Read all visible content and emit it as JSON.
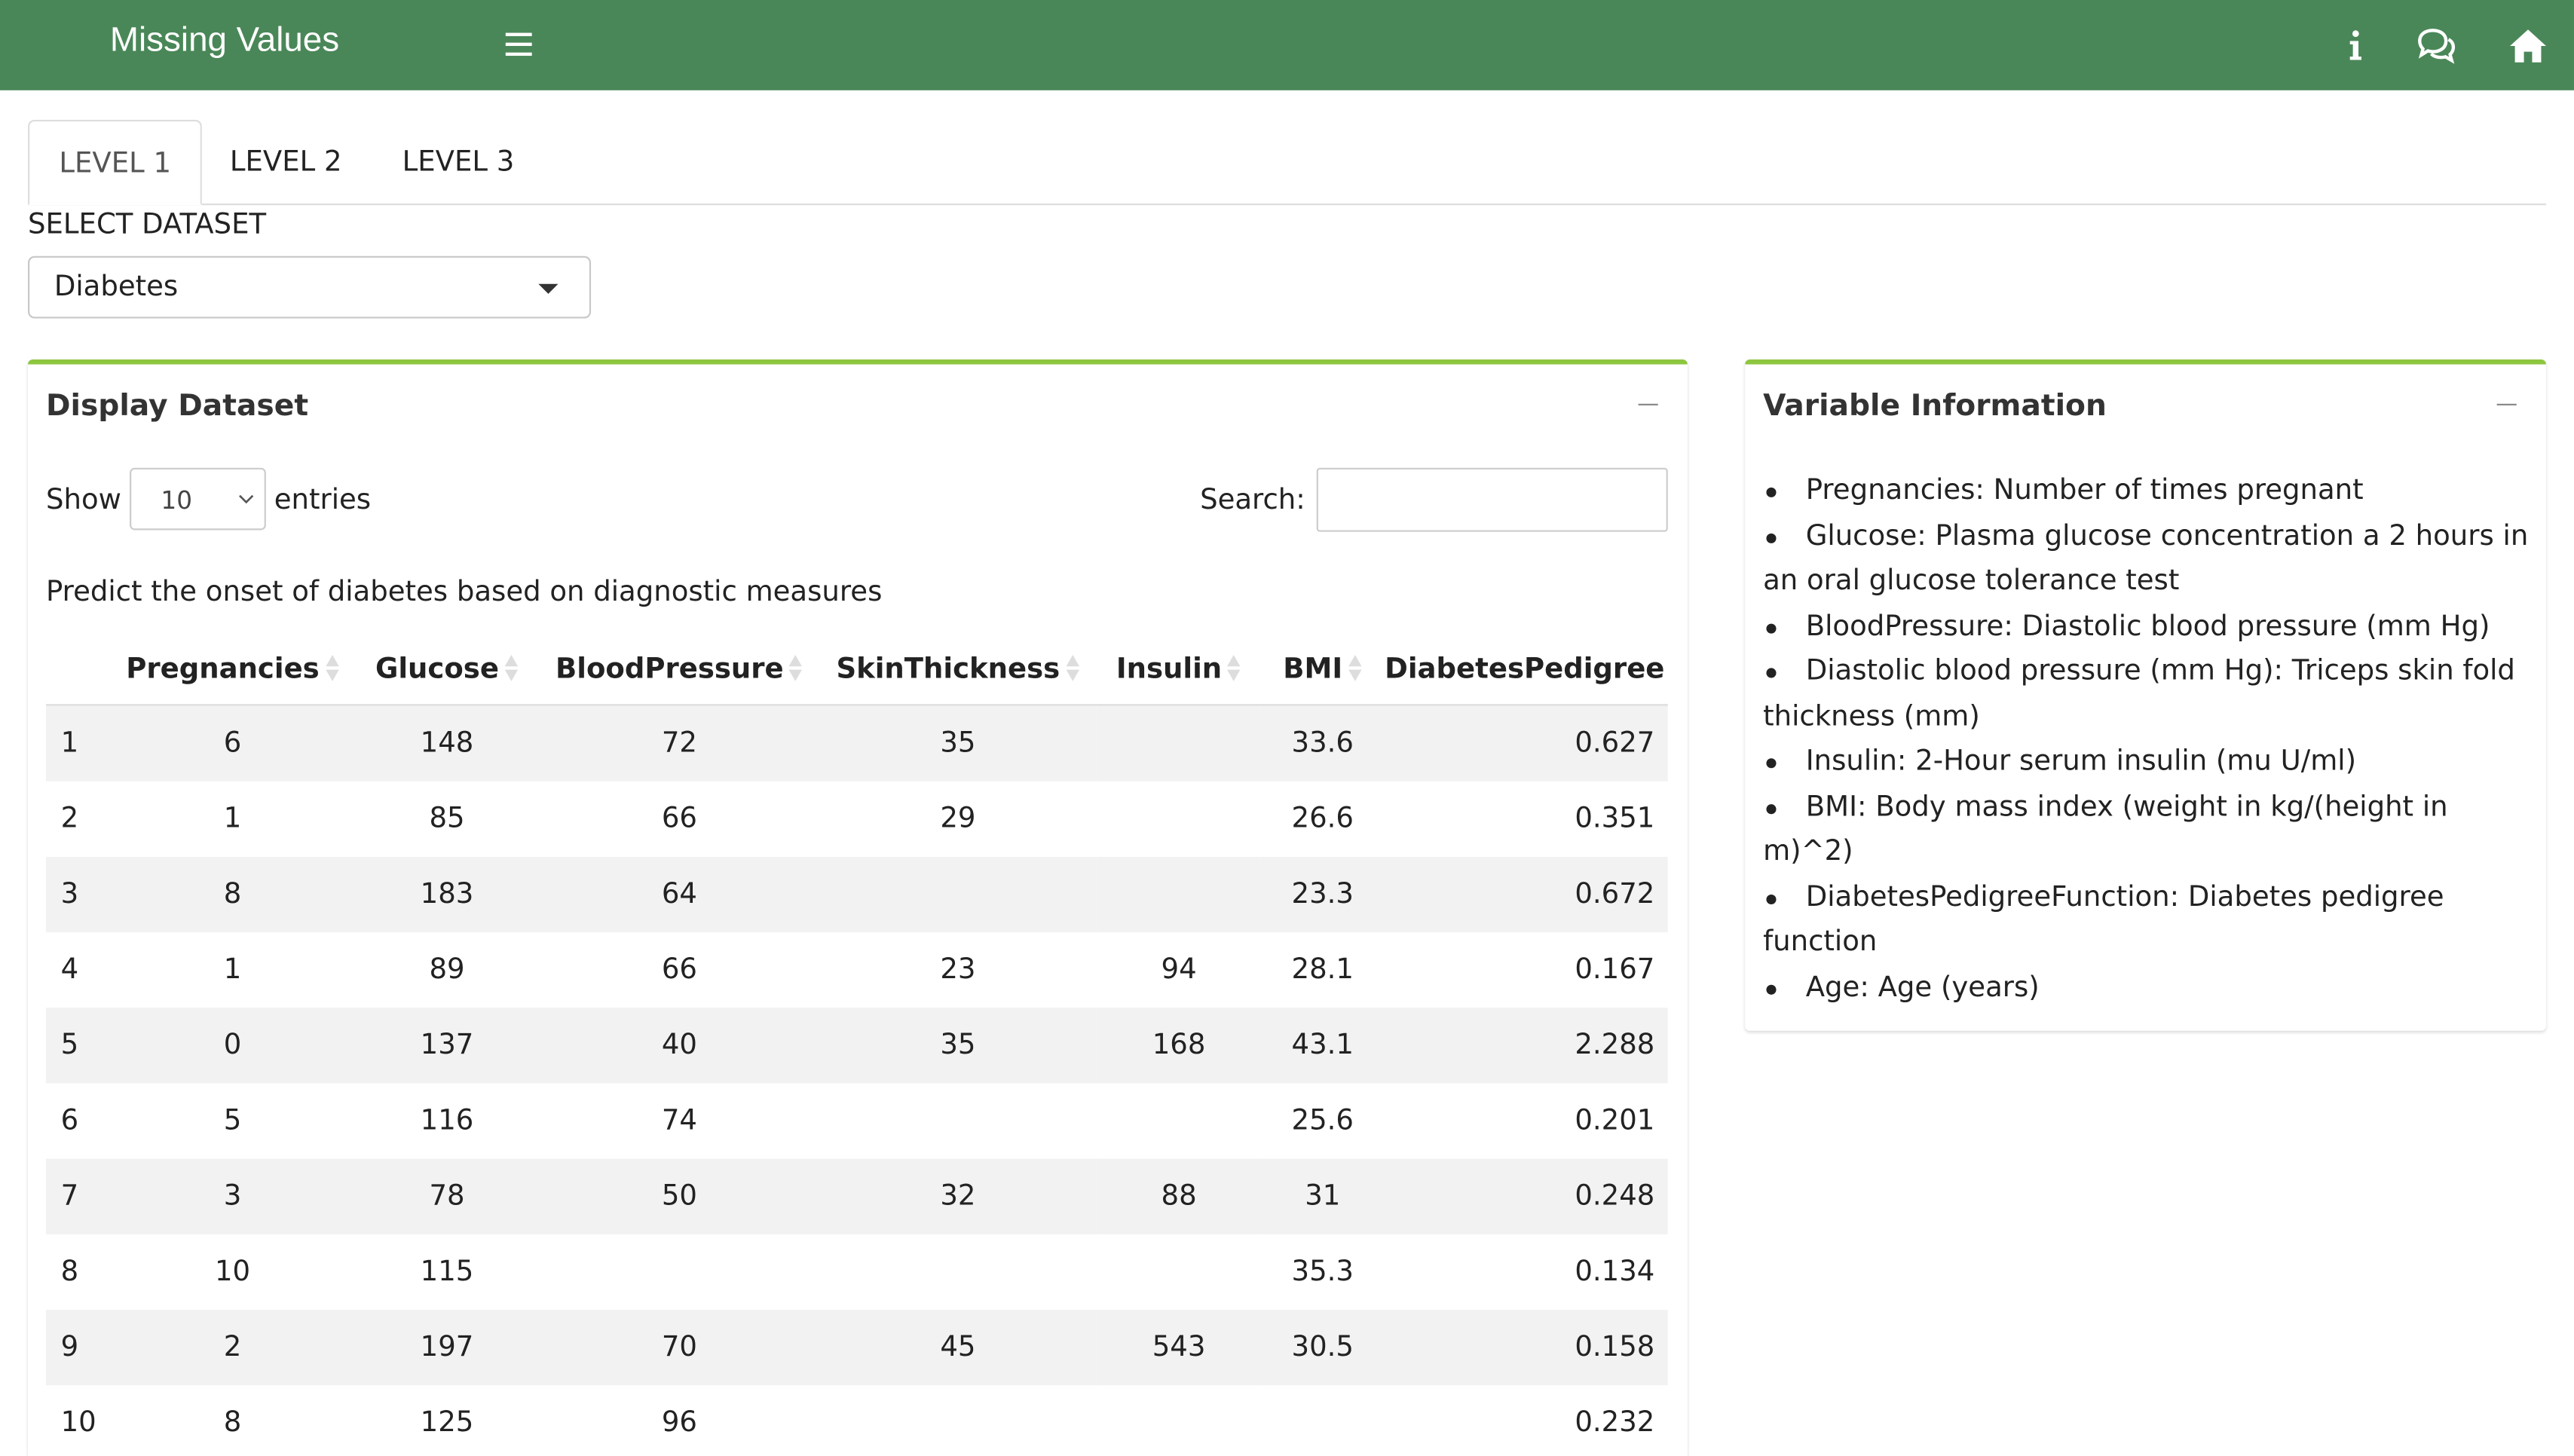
{
  "header": {
    "title": "Missing Values",
    "bg_color": "#4a8758",
    "icons": [
      "menu-icon",
      "info-icon",
      "chat-icon",
      "home-icon"
    ]
  },
  "tabs": [
    {
      "label": "LEVEL 1",
      "active": true
    },
    {
      "label": "LEVEL 2",
      "active": false
    },
    {
      "label": "LEVEL 3",
      "active": false
    }
  ],
  "dataset_select": {
    "label": "SELECT DATASET",
    "value": "Diabetes"
  },
  "display_box": {
    "title": "Display Dataset",
    "show_label": "Show",
    "page_length": "10",
    "entries_label": "entries",
    "search_label": "Search:",
    "search_value": "",
    "caption": "Predict the onset of diabetes based on diagnostic measures",
    "accent_color": "#8dc63f",
    "columns": [
      "",
      "Pregnancies",
      "Glucose",
      "BloodPressure",
      "SkinThickness",
      "Insulin",
      "BMI",
      "DiabetesPedigree"
    ],
    "rows": [
      [
        "1",
        "6",
        "148",
        "72",
        "35",
        "",
        "33.6",
        "0.627"
      ],
      [
        "2",
        "1",
        "85",
        "66",
        "29",
        "",
        "26.6",
        "0.351"
      ],
      [
        "3",
        "8",
        "183",
        "64",
        "",
        "",
        "23.3",
        "0.672"
      ],
      [
        "4",
        "1",
        "89",
        "66",
        "23",
        "94",
        "28.1",
        "0.167"
      ],
      [
        "5",
        "0",
        "137",
        "40",
        "35",
        "168",
        "43.1",
        "2.288"
      ],
      [
        "6",
        "5",
        "116",
        "74",
        "",
        "",
        "25.6",
        "0.201"
      ],
      [
        "7",
        "3",
        "78",
        "50",
        "32",
        "88",
        "31",
        "0.248"
      ],
      [
        "8",
        "10",
        "115",
        "",
        "",
        "",
        "35.3",
        "0.134"
      ],
      [
        "9",
        "2",
        "197",
        "70",
        "45",
        "543",
        "30.5",
        "0.158"
      ],
      [
        "10",
        "8",
        "125",
        "96",
        "",
        "",
        "",
        "0.232"
      ]
    ]
  },
  "variable_box": {
    "title": "Variable Information",
    "items": [
      "Pregnancies: Number of times pregnant",
      "Glucose: Plasma glucose concentration a 2 hours in an oral glucose tolerance test",
      "BloodPressure: Diastolic blood pressure (mm Hg)",
      "Diastolic blood pressure (mm Hg): Triceps skin fold thickness (mm)",
      "Insulin: 2-Hour serum insulin (mu U/ml)",
      "BMI: Body mass index (weight in kg/(height in m)^2)",
      "DiabetesPedigreeFunction: Diabetes pedigree function",
      "Age: Age (years)"
    ]
  }
}
